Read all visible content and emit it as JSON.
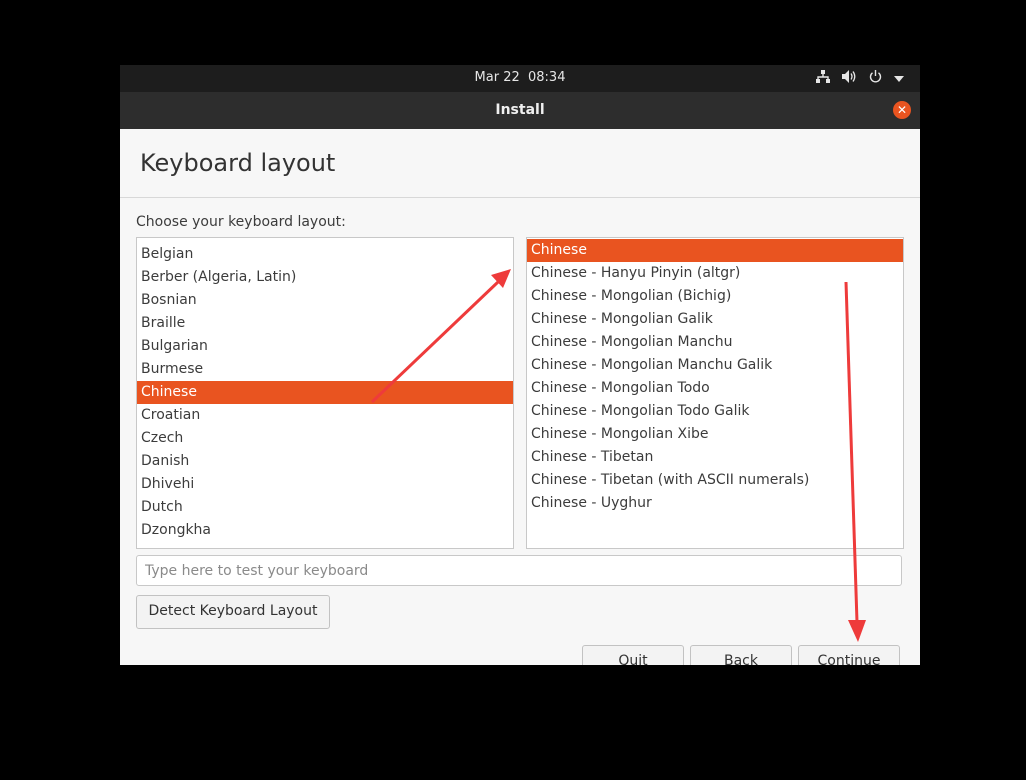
{
  "topbar": {
    "date": "Mar 22",
    "time": "08:34",
    "icons": [
      "network-icon",
      "volume-icon",
      "power-icon",
      "menu-arrow-icon"
    ]
  },
  "window": {
    "title": "Install",
    "close_icon": "close-icon",
    "accent": "#e95420"
  },
  "page": {
    "heading": "Keyboard layout",
    "prompt": "Choose your keyboard layout:"
  },
  "layouts": {
    "items": [
      "Belgian",
      "Berber (Algeria, Latin)",
      "Bosnian",
      "Braille",
      "Bulgarian",
      "Burmese",
      "Chinese",
      "Croatian",
      "Czech",
      "Danish",
      "Dhivehi",
      "Dutch",
      "Dzongkha"
    ],
    "selected": "Chinese"
  },
  "variants": {
    "items": [
      "Chinese",
      "Chinese - Hanyu Pinyin (altgr)",
      "Chinese - Mongolian (Bichig)",
      "Chinese - Mongolian Galik",
      "Chinese - Mongolian Manchu",
      "Chinese - Mongolian Manchu Galik",
      "Chinese - Mongolian Todo",
      "Chinese - Mongolian Todo Galik",
      "Chinese - Mongolian Xibe",
      "Chinese - Tibetan",
      "Chinese - Tibetan (with ASCII numerals)",
      "Chinese - Uyghur"
    ],
    "selected": "Chinese"
  },
  "test_field": {
    "placeholder": "Type here to test your keyboard",
    "value": ""
  },
  "buttons": {
    "detect": "Detect Keyboard Layout",
    "quit": "Quit",
    "back": "Back",
    "continue": "Continue"
  },
  "annotation_color": "#ee3b3b"
}
